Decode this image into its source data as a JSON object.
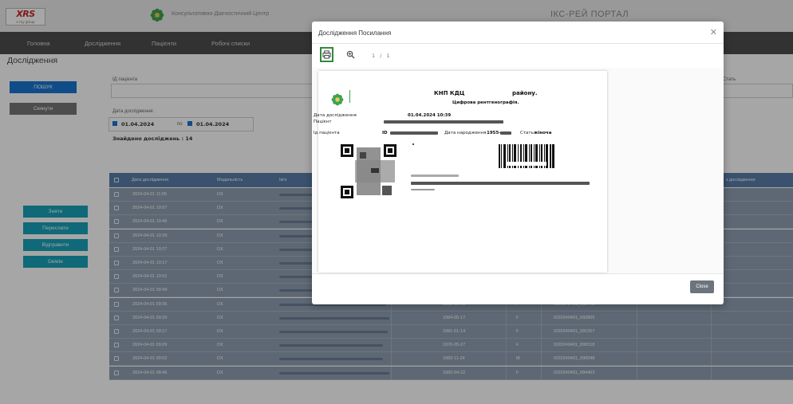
{
  "header": {
    "logo_text": "XRS",
    "logo_sub": "x-ray group",
    "clinic_name": "Консультативно-Діагностичний Центр",
    "portal_title": "ІКС-РЕЙ ПОРТАЛ"
  },
  "nav": {
    "items": [
      {
        "label": "Головна"
      },
      {
        "label": "Дослідження"
      },
      {
        "label": "Пацієнти"
      },
      {
        "label": "Робочі списки"
      }
    ]
  },
  "page": {
    "title": "Дослідження"
  },
  "sidebar": {
    "search_button": "ПОШУК",
    "reset_button": "Скинути",
    "actions": [
      {
        "label": "Зняти"
      },
      {
        "label": "Переслати"
      },
      {
        "label": "Відправити"
      },
      {
        "label": "Delete"
      }
    ]
  },
  "filters": {
    "patient_id_label": "ІД пацієнта",
    "study_date_label": "Дата дослідження:",
    "date_from": "01.04.2024",
    "date_to_label": "по",
    "date_to": "01.04.2024",
    "sex_label": "Стать",
    "found_text": "Знайдено досліджень : 14"
  },
  "table": {
    "columns": [
      "Дата дослідження",
      "Модальність",
      "Ім'я",
      "",
      "",
      "",
      "",
      "",
      "з дослідження"
    ],
    "rows": [
      {
        "datetime": "2024-04-01 11:05",
        "modality": "DX",
        "birth": "",
        "sex": "",
        "study_id": ""
      },
      {
        "datetime": "2024-04-01 10:57",
        "modality": "DX",
        "birth": "",
        "sex": "",
        "study_id": ""
      },
      {
        "datetime": "2024-04-01 10:46",
        "modality": "DX",
        "birth": "",
        "sex": "",
        "study_id": ""
      },
      {
        "datetime": "2024-04-01 10:39",
        "modality": "DX",
        "birth": "",
        "sex": "",
        "study_id": ""
      },
      {
        "datetime": "2024-04-01 10:27",
        "modality": "DX",
        "birth": "",
        "sex": "",
        "study_id": ""
      },
      {
        "datetime": "2024-04-01 10:17",
        "modality": "DX",
        "birth": "",
        "sex": "",
        "study_id": ""
      },
      {
        "datetime": "2024-04-01 10:01",
        "modality": "DX",
        "birth": "",
        "sex": "",
        "study_id": ""
      },
      {
        "datetime": "2024-04-01 09:49",
        "modality": "DX",
        "birth": "",
        "sex": "",
        "study_id": ""
      },
      {
        "datetime": "2024-04-01 09:36",
        "modality": "DX",
        "birth": "1963-01-23",
        "sex": "F",
        "study_id": "ID20240401_093448"
      },
      {
        "datetime": "2024-04-01 09:29",
        "modality": "DX",
        "birth": "1964-05-17",
        "sex": "F",
        "study_id": "ID20240401_092805"
      },
      {
        "datetime": "2024-04-01 09:17",
        "modality": "DX",
        "birth": "1981-01-14",
        "sex": "F",
        "study_id": "ID20240401_091557"
      },
      {
        "datetime": "2024-04-01 09:09",
        "modality": "DX",
        "birth": "1976-05-27",
        "sex": "F",
        "study_id": "ID20240401_090518"
      },
      {
        "datetime": "2024-04-01 09:02",
        "modality": "DX",
        "birth": "1983-11-24",
        "sex": "M",
        "study_id": "ID20240401_090048"
      },
      {
        "datetime": "2024-04-01 08:46",
        "modality": "DX",
        "birth": "1962-04-22",
        "sex": "F",
        "study_id": "ID20240401_084453"
      }
    ]
  },
  "modal": {
    "title": "Дослідження Посилання",
    "page_indicator": "1 / 1",
    "close_label": "Close",
    "document": {
      "org": "КНП КДЦ",
      "region": "району.",
      "subtitle": "Цифрова рентгенографія.",
      "study_date_label": "Дата дослідження",
      "study_date_value": "01.04.2024 10:39",
      "patient_label": "Пацієнт",
      "patient_id_label": "Ід пацієнта",
      "patient_id_value": "ID",
      "birth_label": "Дата народження",
      "birth_value": "1955-",
      "sex_label": "Стать",
      "sex_value": "жіноча"
    }
  },
  "colors": {
    "nav_bg": "#4d4d4d",
    "primary": "#1976d2",
    "action": "#17a2b8",
    "table_header": "#5a7fa8",
    "green_highlight": "#2e8b3c"
  }
}
